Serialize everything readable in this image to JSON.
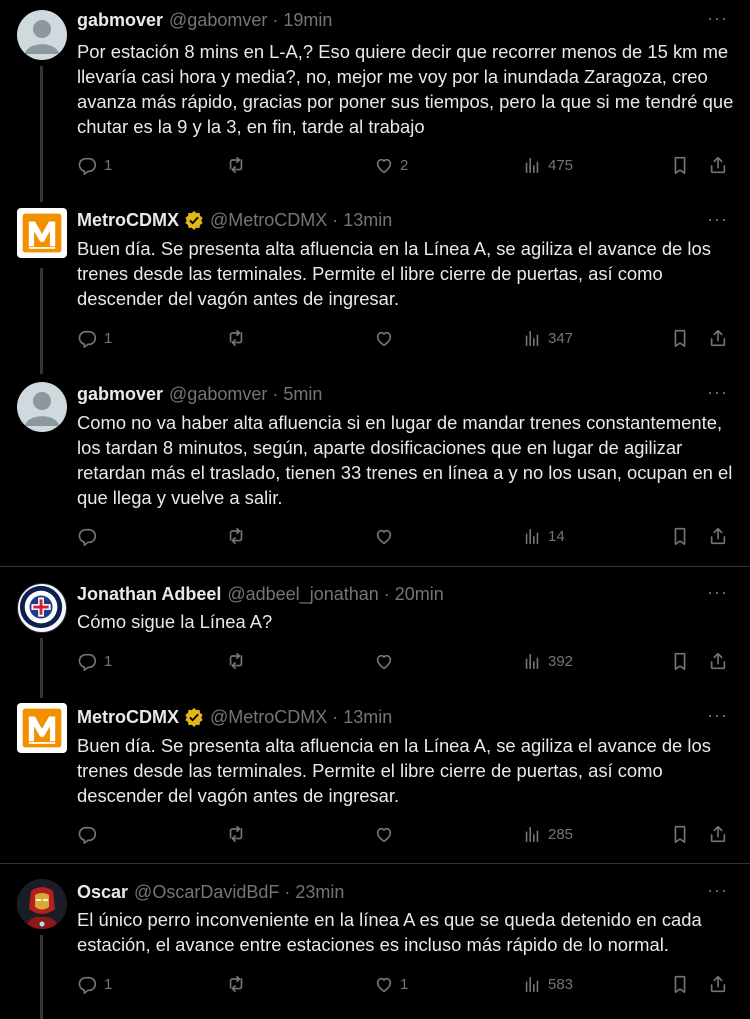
{
  "tweets": [
    {
      "name": "gabmover",
      "handle": "@gabomver",
      "time": "19min",
      "verified": false,
      "text": "Por estación 8 mins en L-A,? Eso quiere decir que recorrer menos de 15 km me llevaría casi hora y media?, no, mejor me voy por la inundada Zaragoza, creo avanza más rápido, gracias por poner sus tiempos, pero la que si me tendré que chutar es la 9 y la 3, en fin, tarde al trabajo",
      "replies": "1",
      "retweets": "",
      "likes": "2",
      "views": "475"
    },
    {
      "name": "MetroCDMX",
      "handle": "@MetroCDMX",
      "time": "13min",
      "verified": true,
      "text": "Buen día. Se presenta alta afluencia en la Línea A, se agiliza el avance de los trenes desde las terminales. Permite el libre cierre de puertas, así como descender del vagón antes de ingresar.",
      "replies": "1",
      "retweets": "",
      "likes": "",
      "views": "347"
    },
    {
      "name": "gabmover",
      "handle": "@gabomver",
      "time": "5min",
      "verified": false,
      "text": "Como no va haber alta afluencia si en lugar de mandar trenes constantemente, los tardan 8 minutos, según, aparte dosificaciones que en lugar de agilizar retardan más el traslado, tienen 33 trenes en línea a y no los usan, ocupan en el que llega y vuelve a salir.",
      "replies": "",
      "retweets": "",
      "likes": "",
      "views": "14"
    },
    {
      "name": "Jonathan Adbeel",
      "handle": "@adbeel_jonathan",
      "time": "20min",
      "verified": false,
      "text": "Cómo sigue la Línea A?",
      "replies": "1",
      "retweets": "",
      "likes": "",
      "views": "392"
    },
    {
      "name": "MetroCDMX",
      "handle": "@MetroCDMX",
      "time": "13min",
      "verified": true,
      "text": "Buen día. Se presenta alta afluencia en la Línea A, se agiliza el avance de los trenes desde las terminales. Permite el libre cierre de puertas, así como descender del vagón antes de ingresar.",
      "replies": "",
      "retweets": "",
      "likes": "",
      "views": "285"
    },
    {
      "name": "Oscar",
      "handle": "@OscarDavidBdF",
      "time": "23min",
      "verified": false,
      "text": "El único perro inconveniente en la línea A es que se queda detenido en cada estación, el avance entre estaciones es incluso más rápido de lo normal.",
      "replies": "1",
      "retweets": "",
      "likes": "1",
      "views": "583"
    }
  ],
  "separator": "·",
  "more_glyph": "···",
  "colors": {
    "background": "#000000",
    "text": "#e7e9ea",
    "muted": "#71767b",
    "verified": "#e2b719",
    "divider": "#2f3336"
  }
}
